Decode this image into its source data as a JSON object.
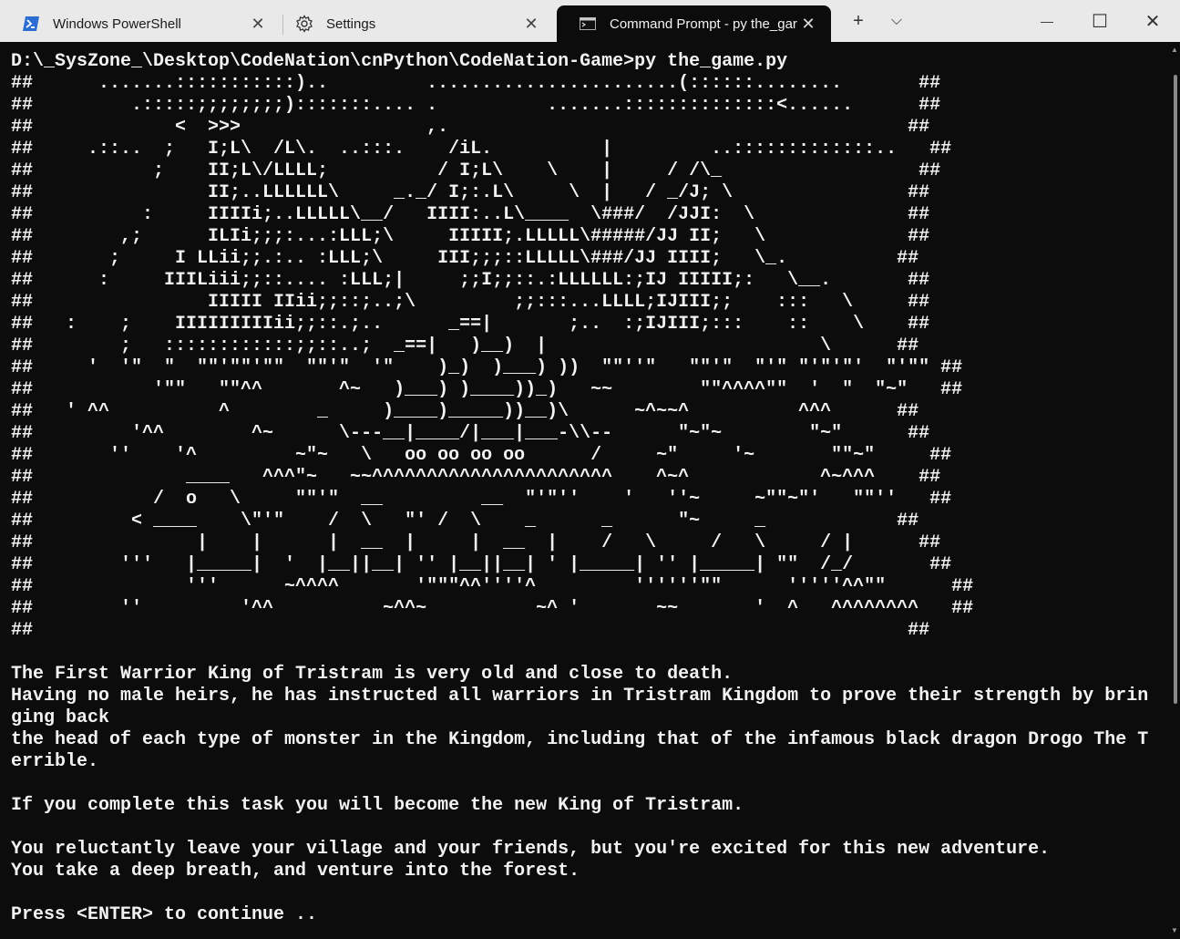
{
  "tabs": [
    {
      "label": "Windows PowerShell",
      "icon": "powershell-icon",
      "active": false
    },
    {
      "label": "Settings",
      "icon": "gear-icon",
      "active": false
    },
    {
      "label": "Command Prompt - py  the_gar",
      "icon": "cmd-icon",
      "active": true
    }
  ],
  "titlebar": {
    "new_tab": "+",
    "dropdown": "⌵",
    "minimize": "—",
    "maximize": "☐",
    "close": "✕"
  },
  "terminal": {
    "lines": [
      "D:\\_SysZone_\\Desktop\\CodeNation\\cnPython\\CodeNation-Game>py the_game.py",
      "##      .......:::::::::::)..         .......................(::::::........       ##",
      "##         .:::::;;;;;;;;):::::::.... .          .......::::::::::::::<......      ##",
      "##             <  >>>                 ,.                                          ##",
      "##     .::..  ;   I;L\\  /L\\.  ..:::.    /iL.          |         ..:::::::::::::..   ##",
      "##           ;    II;L\\/LLLL;          / I;L\\    \\    |     / /\\_                  ##",
      "##                II;..LLLLLL\\     _._/ I;:.L\\     \\  |   / _/J; \\                ##",
      "##          :     IIIIi;..LLLLL\\__/   IIII:..L\\____  \\###/  /JJI:  \\              ##",
      "##        ,;      ILIi;;;:...:LLL;\\     IIIII;.LLLLL\\#####/JJ II;   \\             ##",
      "##       ;     I LLii;;.:.. :LLL;\\     III;;;::LLLLL\\###/JJ IIII;   \\_.          ##",
      "##      :     IIILiii;;::.... :LLL;|     ;;I;;::.:LLLLLL:;IJ IIIII;:   \\__.       ##",
      "##                IIIII IIii;;::;..;\\         ;;:::...LLLL;IJIII;;    :::   \\     ##",
      "##   :    ;    IIIIIIIIIii;;::.;..      _==|       ;..  :;IJIII;:::    ::    \\    ##",
      "##        ;   ::::::::::::;;::..;  _==|   )__)  |                         \\      ##",
      "##     '  '\"  \"  \"\"'\"\"'\"\"  \"\"'\"  '\"    )_)  )___) ))  \"\"''\"   \"\"'\"  \"'\" \"'\"'\"'  \"'\"\" ##",
      "##           '\"\"   \"\"^^       ^~   )___) )____))_)   ~~        \"\"^^^^\"\"  '  \"  \"~\"   ##",
      "##   ' ^^          ^        _     )____)_____))__)\\      ~^~~^          ^^^      ##",
      "##         '^^        ^~      \\---__|____/|___|___-\\\\--      \"~\"~        \"~\"      ##",
      "##       ''    '^         ~\"~   \\   oo oo oo oo      /     ~\"     '~       \"\"~\"     ##",
      "##              ____   ^^^\"~   ~~^^^^^^^^^^^^^^^^^^^^^^    ^~^            ^~^^^    ##",
      "##           /  o   \\     \"\"'\"  __         __  \"'\"''    '   ''~     ~\"\"~\"'   \"\"''   ##",
      "##         < ____    \\\"'\"    /  \\   \"' /  \\    _      _      \"~     _            ##",
      "##               |    |      |  __  |     |  __  |    /   \\     /   \\     / |      ##",
      "##        '''   |_____|  '  |__||__| '' |__||__| ' |_____| '' |_____| \"\"  /_/       ##",
      "##              '''      ~^^^^       '\"\"\"^^''''^         ''''''\"\"      '''''^^\"\"      ##",
      "##        ''         '^^          ~^^~          ~^ '       ~~       '  ^   ^^^^^^^^   ##",
      "##                                                                                ##",
      "",
      "The First Warrior King of Tristram is very old and close to death.",
      "Having no male heirs, he has instructed all warriors in Tristram Kingdom to prove their strength by brin",
      "ging back",
      "the head of each type of monster in the Kingdom, including that of the infamous black dragon Drogo The T",
      "errible.",
      "",
      "If you complete this task you will become the new King of Tristram.",
      "",
      "You reluctantly leave your village and your friends, but you're excited for this new adventure.",
      "You take a deep breath, and venture into the forest.",
      "",
      "Press <ENTER> to continue .."
    ]
  },
  "colors": {
    "terminal_bg": "#0c0c0c",
    "terminal_fg": "#f2f2f2",
    "titlebar_bg": "#e9e9e9",
    "powershell_blue": "#2b6dd3"
  }
}
